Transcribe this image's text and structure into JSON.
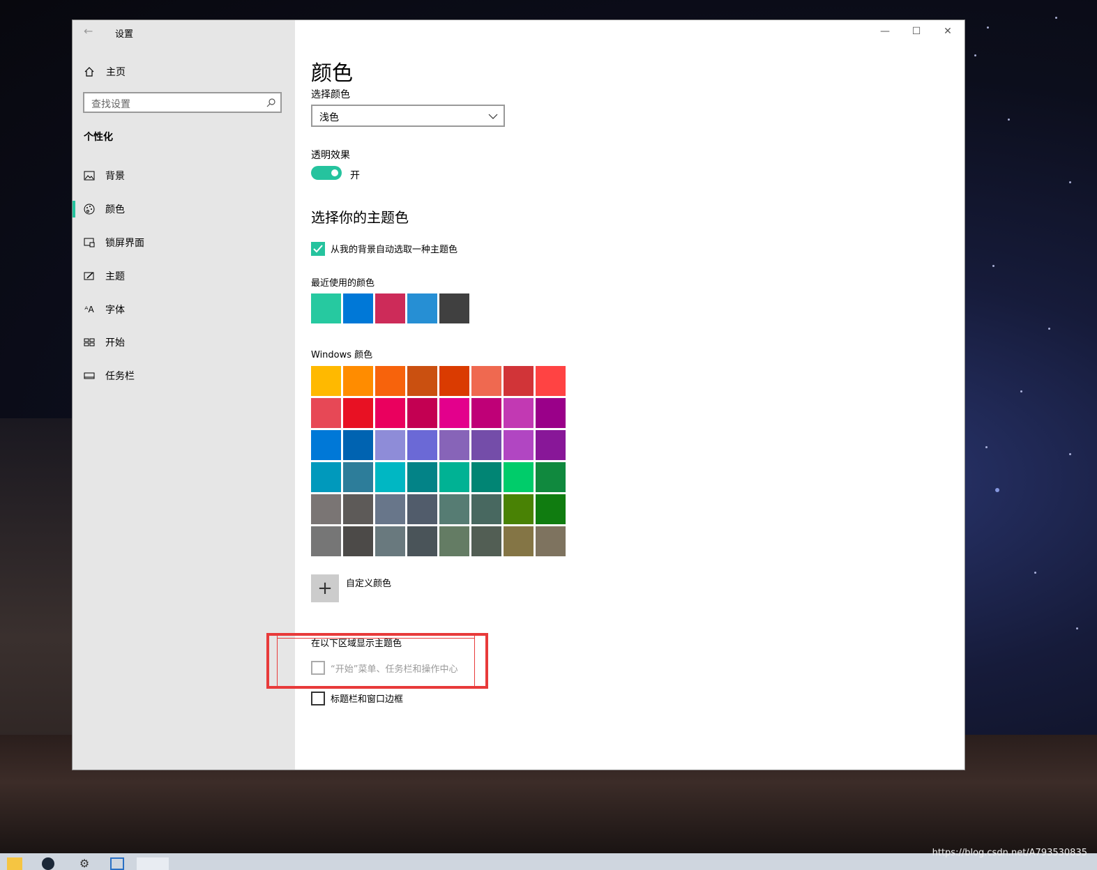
{
  "window": {
    "title": "设置",
    "minimize": "—",
    "maximize": "☐",
    "close": "✕"
  },
  "sidebar": {
    "home_label": "主页",
    "search_placeholder": "查找设置",
    "section": "个性化",
    "items": [
      {
        "label": "背景",
        "icon": "picture-icon"
      },
      {
        "label": "颜色",
        "icon": "palette-icon",
        "active": true
      },
      {
        "label": "锁屏界面",
        "icon": "lockscreen-icon"
      },
      {
        "label": "主题",
        "icon": "theme-icon"
      },
      {
        "label": "字体",
        "icon": "font-icon"
      },
      {
        "label": "开始",
        "icon": "start-icon"
      },
      {
        "label": "任务栏",
        "icon": "taskbar-icon"
      }
    ]
  },
  "main": {
    "title": "颜色",
    "choose_color_label": "选择颜色",
    "choose_color_value": "浅色",
    "transparency_label": "透明效果",
    "transparency_state": "开",
    "accent_heading": "选择你的主题色",
    "auto_pick_label": "从我的背景自动选取一种主题色",
    "recent_label": "最近使用的颜色",
    "recent_colors": [
      "#26c9a0",
      "#0078d7",
      "#cd2b59",
      "#268fd4",
      "#404040"
    ],
    "windows_colors_label": "Windows 颜色",
    "windows_colors": [
      [
        "#ffb900",
        "#ff8c00",
        "#f7630c",
        "#ca5010",
        "#da3b01",
        "#ef6950",
        "#d13438",
        "#ff4343"
      ],
      [
        "#e74856",
        "#e81123",
        "#ea005e",
        "#c30052",
        "#e3008c",
        "#bf0077",
        "#c239b3",
        "#9a0089"
      ],
      [
        "#0078d7",
        "#0063b1",
        "#8e8cd8",
        "#6b69d6",
        "#8764b8",
        "#744da9",
        "#b146c2",
        "#881798"
      ],
      [
        "#0099bc",
        "#2d7d9a",
        "#00b7c3",
        "#038387",
        "#00b294",
        "#018574",
        "#00cc6a",
        "#10893e"
      ],
      [
        "#7a7574",
        "#5d5a58",
        "#68768a",
        "#515c6b",
        "#567c73",
        "#486860",
        "#498205",
        "#107c10"
      ],
      [
        "#767676",
        "#4c4a48",
        "#69797e",
        "#4a5459",
        "#647c64",
        "#525e54",
        "#847545",
        "#7e735f"
      ]
    ],
    "custom_color_label": "自定义颜色",
    "show_accent_label": "在以下区域显示主题色",
    "start_taskbar_label": "“开始”菜单、任务栏和操作中心",
    "titlebar_label": "标题栏和窗口边框"
  },
  "watermark": "https://blog.csdn.net/A793530835",
  "colors": {
    "accent": "#25c39e",
    "highlight_box": "#e83a3a"
  }
}
